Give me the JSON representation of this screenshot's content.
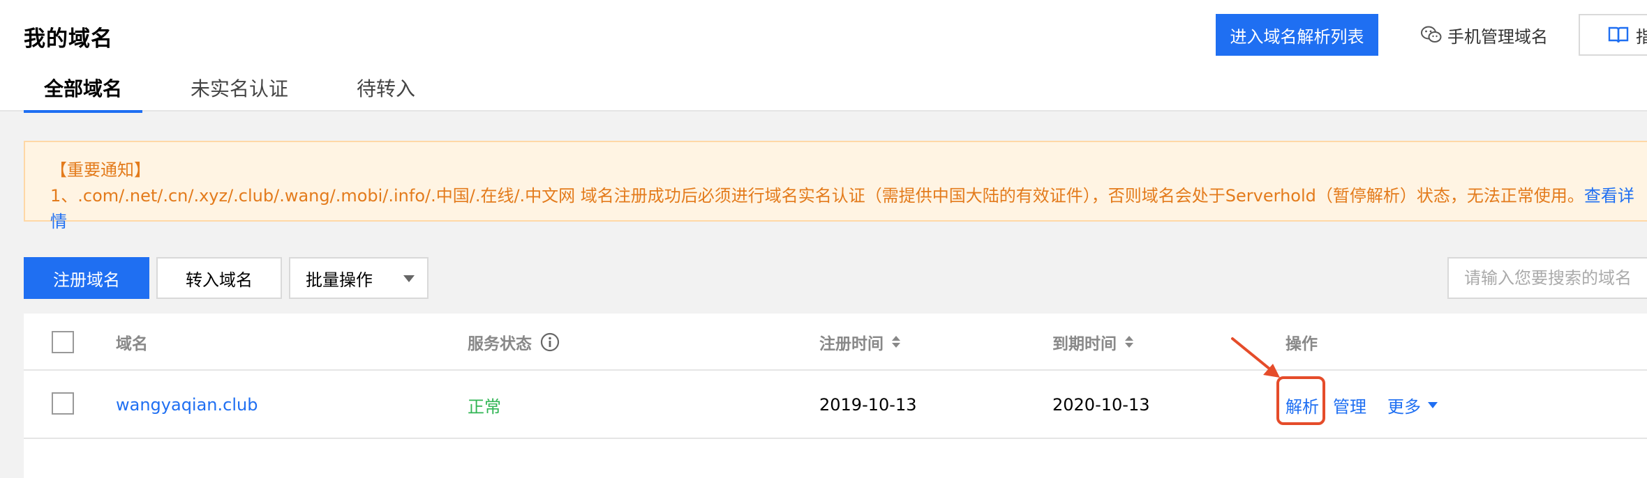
{
  "header": {
    "title": "我的域名",
    "primary_button": "进入域名解析列表",
    "mobile_manage": "手机管理域名",
    "guide_button": "指"
  },
  "tabs": [
    {
      "label": "全部域名",
      "active": true
    },
    {
      "label": "未实名认证",
      "active": false
    },
    {
      "label": "待转入",
      "active": false
    }
  ],
  "notice": {
    "title": "【重要通知】",
    "text": "1、.com/.net/.cn/.xyz/.club/.wang/.mobi/.info/.中国/.在线/.中文网 域名注册成功后必须进行域名实名认证（需提供中国大陆的有效证件），否则域名会处于Serverhold（暂停解析）状态，无法正常使用。",
    "link": "查看详情"
  },
  "toolbar": {
    "register": "注册域名",
    "transfer": "转入域名",
    "batch": "批量操作",
    "search_placeholder": "请输入您要搜索的域名"
  },
  "table": {
    "headers": {
      "domain": "域名",
      "status": "服务状态",
      "reg_time": "注册时间",
      "exp_time": "到期时间",
      "actions": "操作"
    },
    "rows": [
      {
        "domain": "wangyaqian.club",
        "status": "正常",
        "reg_time": "2019-10-13",
        "exp_time": "2020-10-13",
        "actions": {
          "resolve": "解析",
          "manage": "管理",
          "more": "更多"
        }
      }
    ]
  },
  "colors": {
    "primary": "#1f6ff2",
    "notice_text": "#e37b1c",
    "status_ok": "#31b554",
    "highlight": "#e54c2a"
  }
}
